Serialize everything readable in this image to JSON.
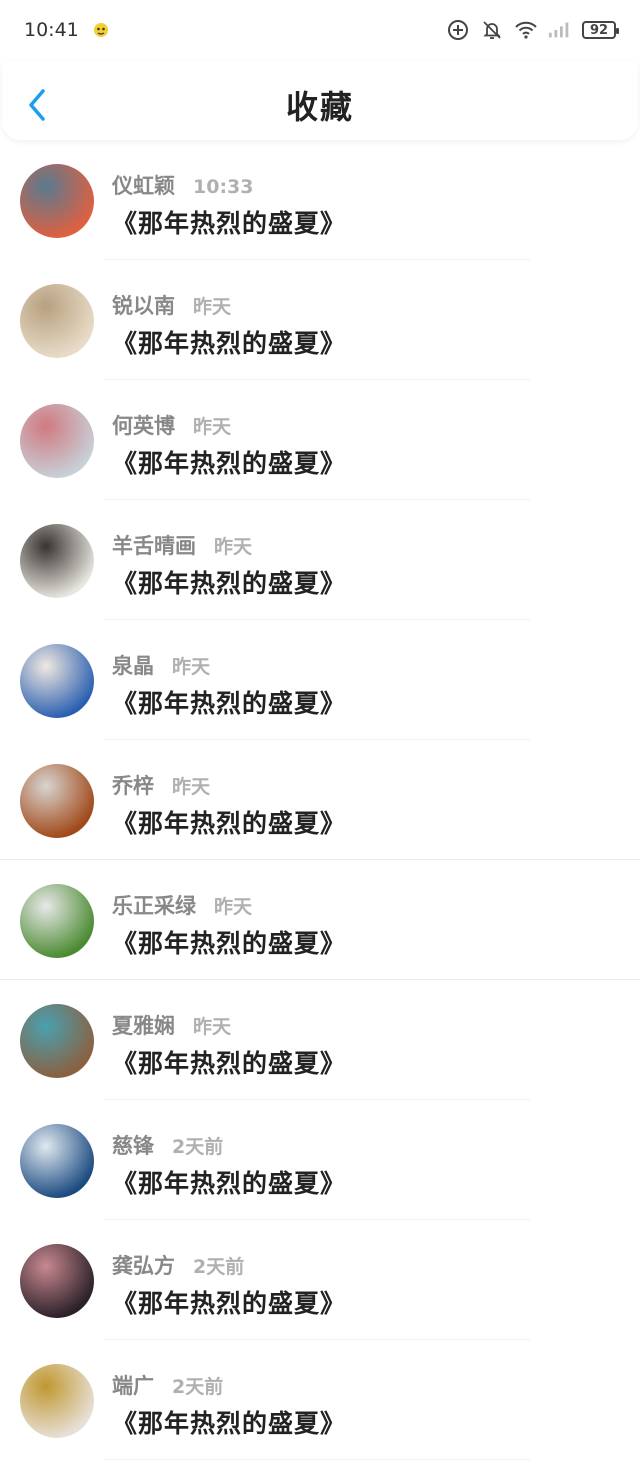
{
  "status_bar": {
    "time": "10:41",
    "battery": "92",
    "icons": [
      "add-circle-icon",
      "bell-off-icon",
      "wifi-icon",
      "signal-icon",
      "battery-icon"
    ]
  },
  "header": {
    "title": "收藏",
    "back_icon": "chevron-left-icon"
  },
  "colors": {
    "accent": "#1a9ff0",
    "name": "#888888",
    "time": "#b0b0b0"
  },
  "favorites": [
    {
      "name": "仪虹颖",
      "time": "10:33",
      "title": "《那年热烈的盛夏》",
      "avatar_colors": [
        "#e06040",
        "#5a7a90"
      ]
    },
    {
      "name": "锐以南",
      "time": "昨天",
      "title": "《那年热烈的盛夏》",
      "avatar_colors": [
        "#e8dcc8",
        "#b8a080"
      ]
    },
    {
      "name": "何英博",
      "time": "昨天",
      "title": "《那年热烈的盛夏》",
      "avatar_colors": [
        "#c8d0d8",
        "#d07a80"
      ]
    },
    {
      "name": "羊舌晴画",
      "time": "昨天",
      "title": "《那年热烈的盛夏》",
      "avatar_colors": [
        "#e8e6e0",
        "#3a3430"
      ]
    },
    {
      "name": "泉晶",
      "time": "昨天",
      "title": "《那年热烈的盛夏》",
      "avatar_colors": [
        "#2a5fb0",
        "#f0e8e0"
      ]
    },
    {
      "name": "乔梓",
      "time": "昨天",
      "title": "《那年热烈的盛夏》",
      "avatar_colors": [
        "#a04818",
        "#d8d4d0"
      ]
    },
    {
      "name": "乐正采绿",
      "time": "昨天",
      "title": "《那年热烈的盛夏》",
      "avatar_colors": [
        "#4a8a30",
        "#e8e8e8"
      ]
    },
    {
      "name": "夏雅娴",
      "time": "昨天",
      "title": "《那年热烈的盛夏》",
      "avatar_colors": [
        "#8a6040",
        "#4aa0b0"
      ]
    },
    {
      "name": "慈锋",
      "time": "2天前",
      "title": "《那年热烈的盛夏》",
      "avatar_colors": [
        "#1a4a80",
        "#e0e8f0"
      ]
    },
    {
      "name": "龚弘方",
      "time": "2天前",
      "title": "《那年热烈的盛夏》",
      "avatar_colors": [
        "#2a2028",
        "#c88890"
      ]
    },
    {
      "name": "端广",
      "time": "2天前",
      "title": "《那年热烈的盛夏》",
      "avatar_colors": [
        "#e8e0d8",
        "#c09830"
      ]
    }
  ]
}
